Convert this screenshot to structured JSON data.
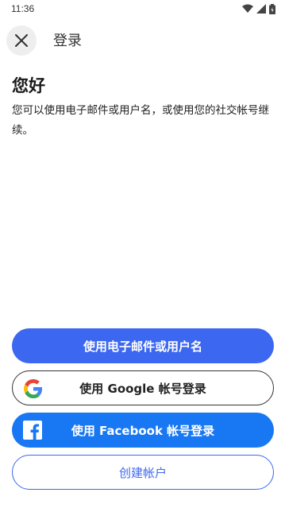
{
  "status_bar": {
    "time": "11:36"
  },
  "header": {
    "title": "登录"
  },
  "main": {
    "greeting": "您好",
    "description": "您可以使用电子邮件或用户名，或使用您的社交帐号继续。"
  },
  "buttons": {
    "email_label": "使用电子邮件或用户名",
    "google_label": "使用 Google 帐号登录",
    "facebook_label": "使用 Facebook 帐号登录",
    "create_label": "创建帐户"
  },
  "colors": {
    "primary": "#3c67f0",
    "facebook": "#1877f2"
  }
}
